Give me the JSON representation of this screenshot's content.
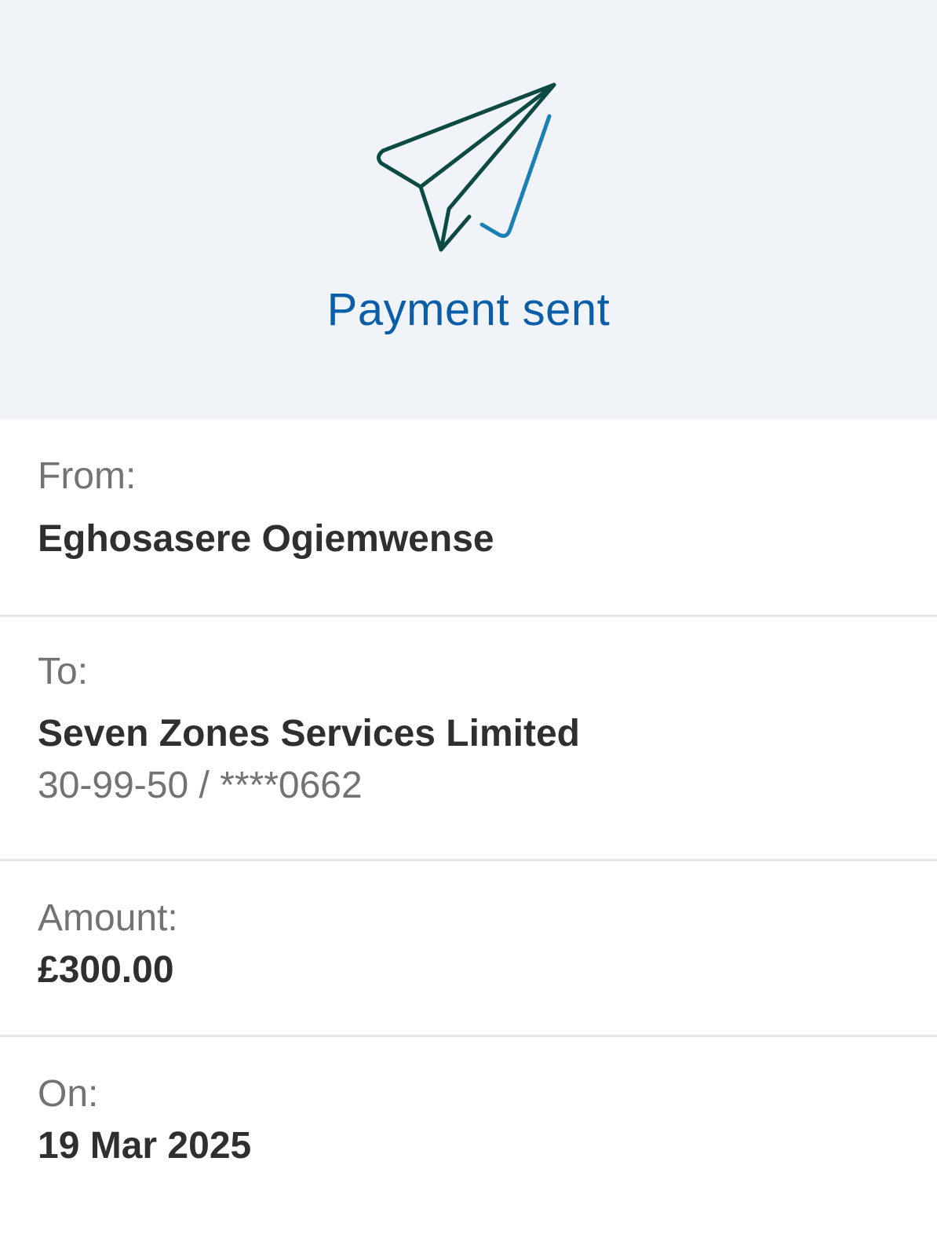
{
  "header": {
    "icon": "paper-plane-check-icon",
    "title": "Payment sent",
    "colors": {
      "background": "#f0f4f9",
      "title": "#0a5ea8",
      "plane": "#0c4a43",
      "check": "#1a7fb5"
    }
  },
  "details": {
    "from": {
      "label": "From:",
      "value": "Eghosasere Ogiemwense"
    },
    "to": {
      "label": "To:",
      "value": "Seven Zones Services Limited",
      "account": "30-99-50 / ****0662"
    },
    "amount": {
      "label": "Amount:",
      "value": "£300.00"
    },
    "on": {
      "label": "On:",
      "value": "19 Mar 2025"
    }
  }
}
